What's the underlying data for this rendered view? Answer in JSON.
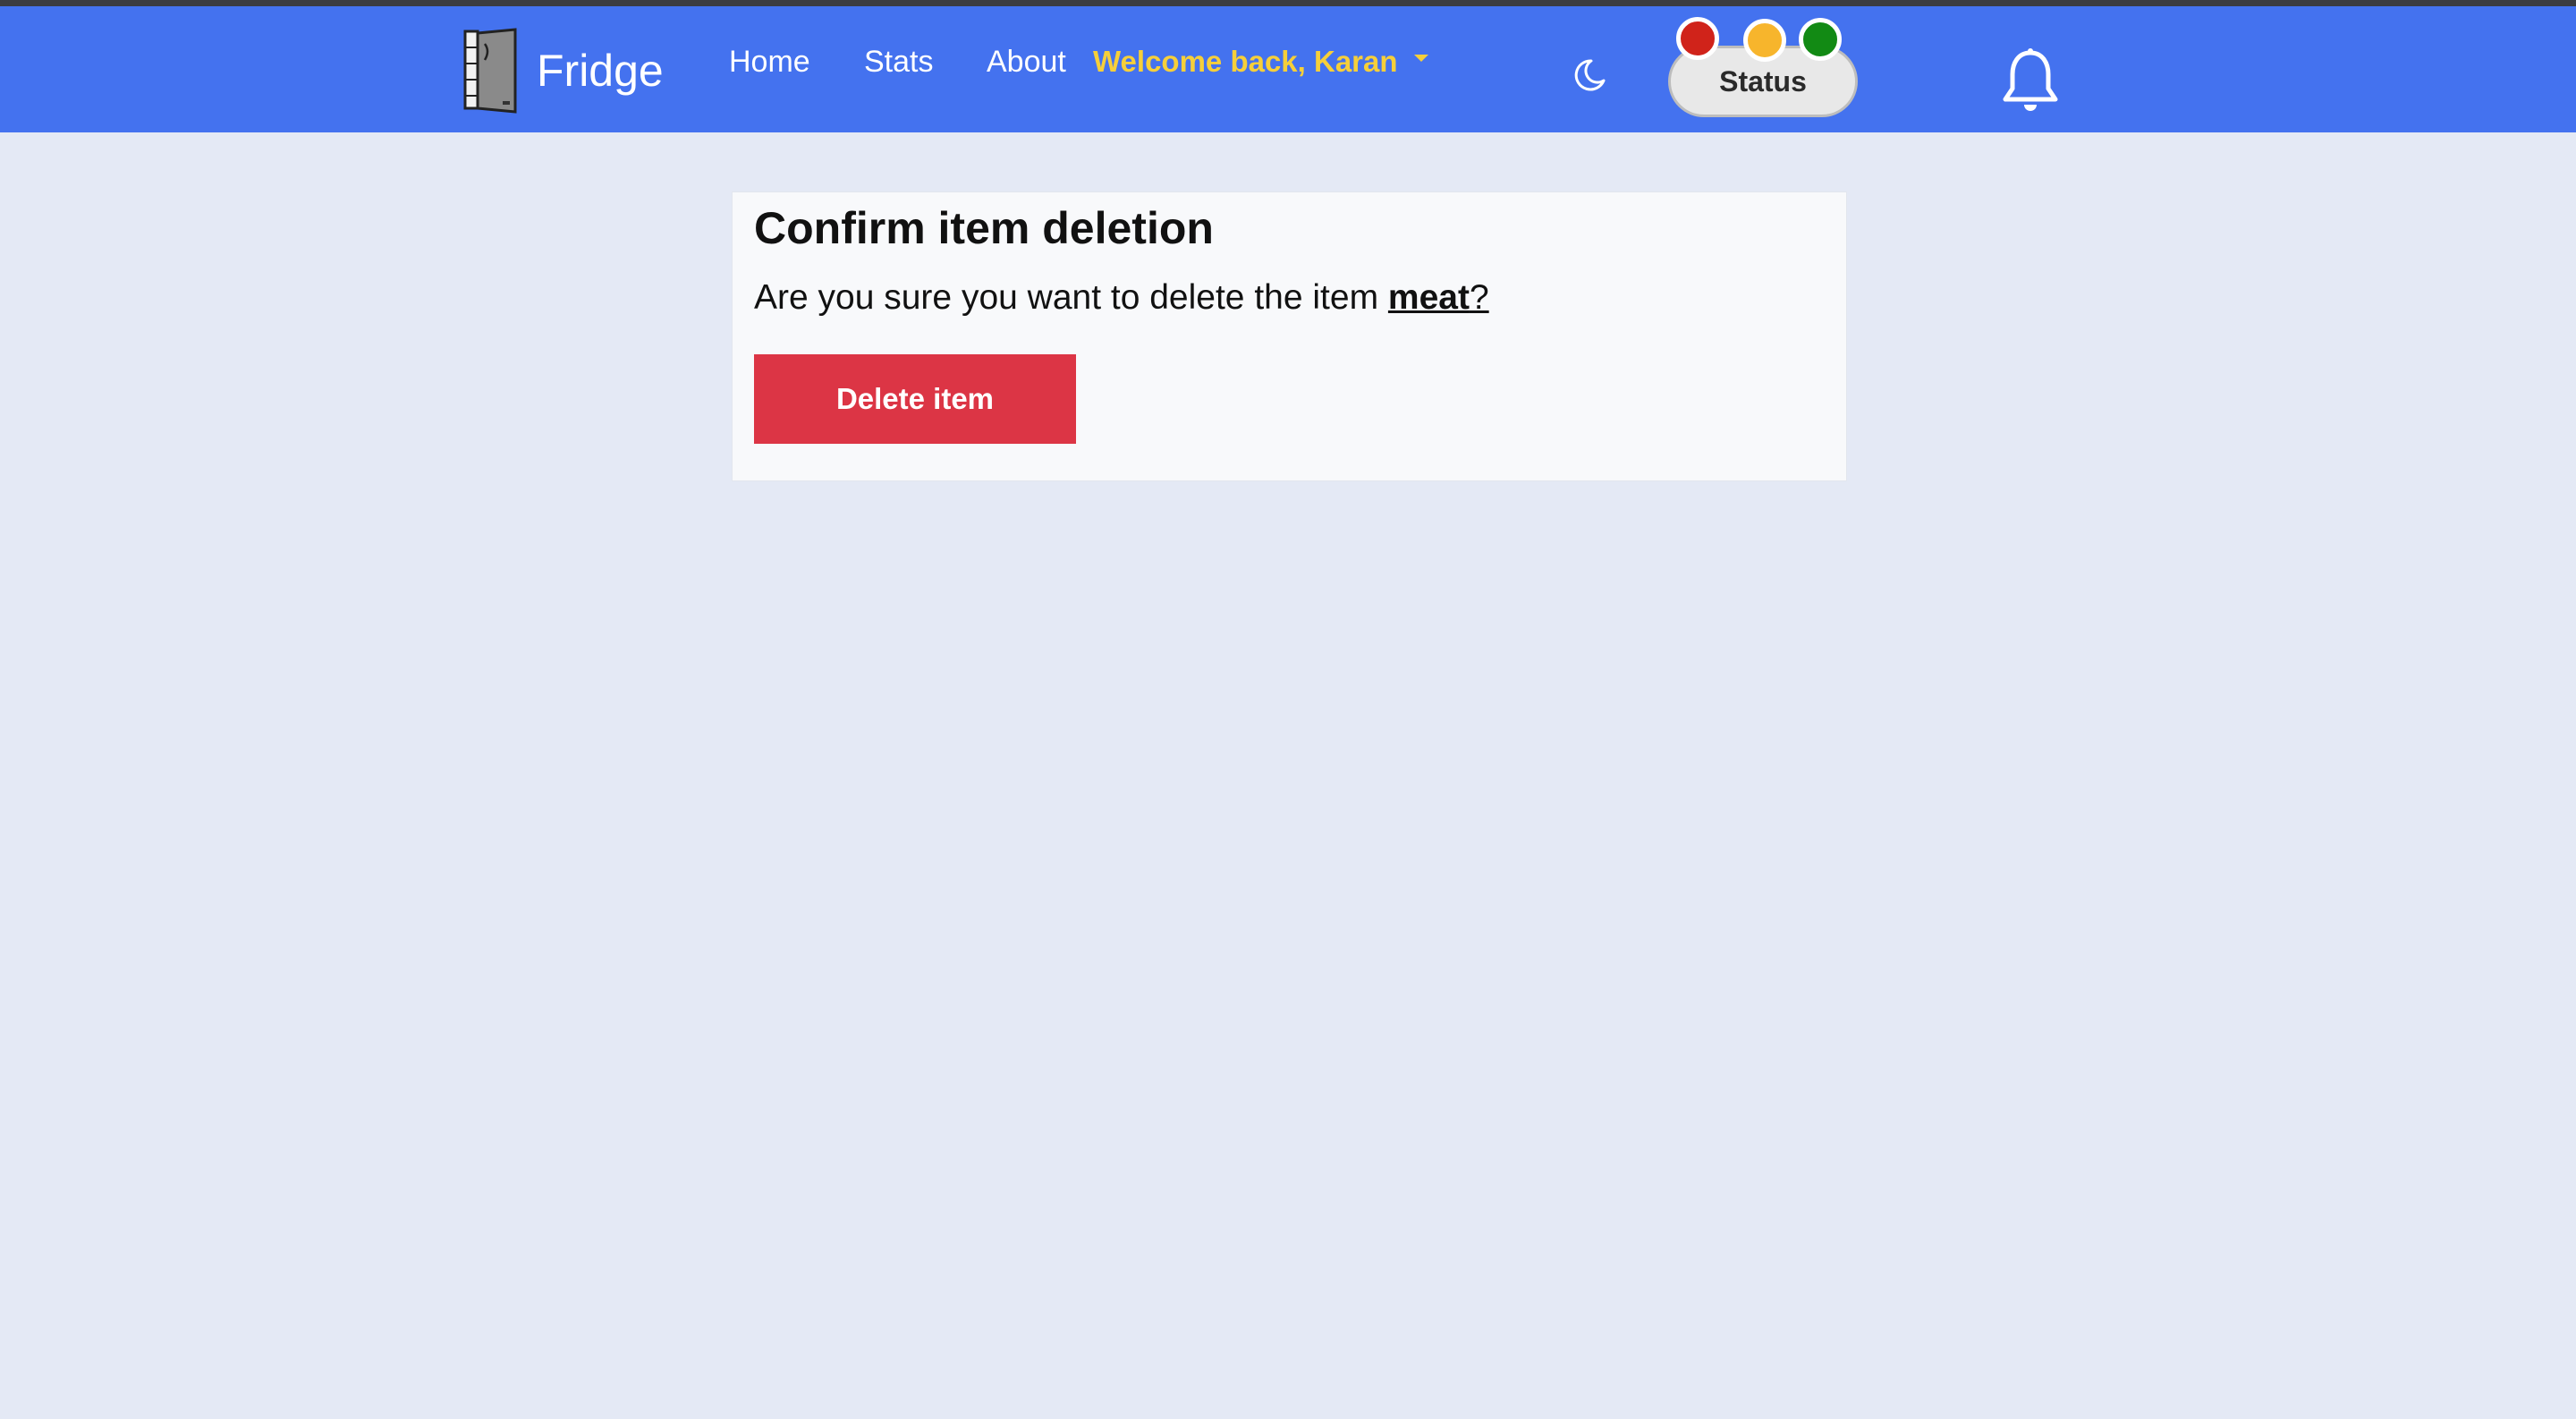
{
  "navbar": {
    "brand": "Fridge",
    "links": [
      "Home",
      "Stats",
      "About"
    ],
    "user_menu_label": "Welcome back, Karan",
    "status_label": "Status",
    "colors": {
      "navbar_bg": "#4472ef",
      "user_text": "#f6cf3a",
      "light_red": "#d0231a",
      "light_yellow": "#f7b52c",
      "light_green": "#128a14"
    }
  },
  "card": {
    "title": "Confirm item deletion",
    "prompt_prefix": "Are you sure you want to delete the item ",
    "item_name": "meat",
    "prompt_suffix": "?",
    "delete_button": "Delete item",
    "delete_color": "#dc3545"
  },
  "icons": [
    "fridge-logo-icon",
    "moon-icon",
    "bell-icon",
    "chevron-down-icon"
  ]
}
